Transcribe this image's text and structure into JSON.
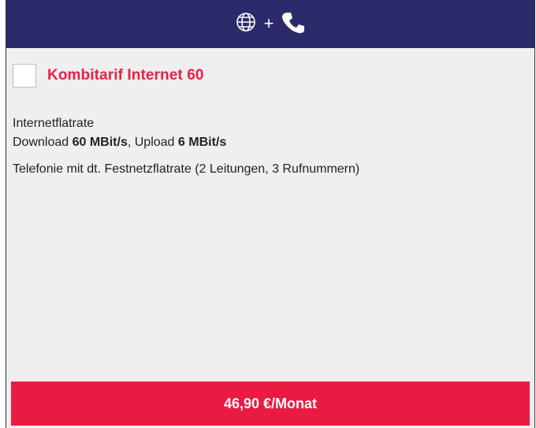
{
  "header": {
    "plus_sign": "+",
    "background": "#2b2a6b",
    "icons": [
      "globe-icon",
      "phone-icon"
    ]
  },
  "product": {
    "title": "Kombitarif Internet 60",
    "title_color": "#ea1f44",
    "checked": false
  },
  "features": {
    "internet_label": "Internetflatrate",
    "download_label": "Download ",
    "download_value": "60 MBit/s",
    "separator": ", Upload ",
    "upload_value": "6 MBit/s",
    "telephony": "Telefonie mit dt. Festnetzflatrate (2 Leitungen, 3 Rufnummern)"
  },
  "price": {
    "label": "46,90 €/Monat",
    "background": "#ea1b43"
  }
}
